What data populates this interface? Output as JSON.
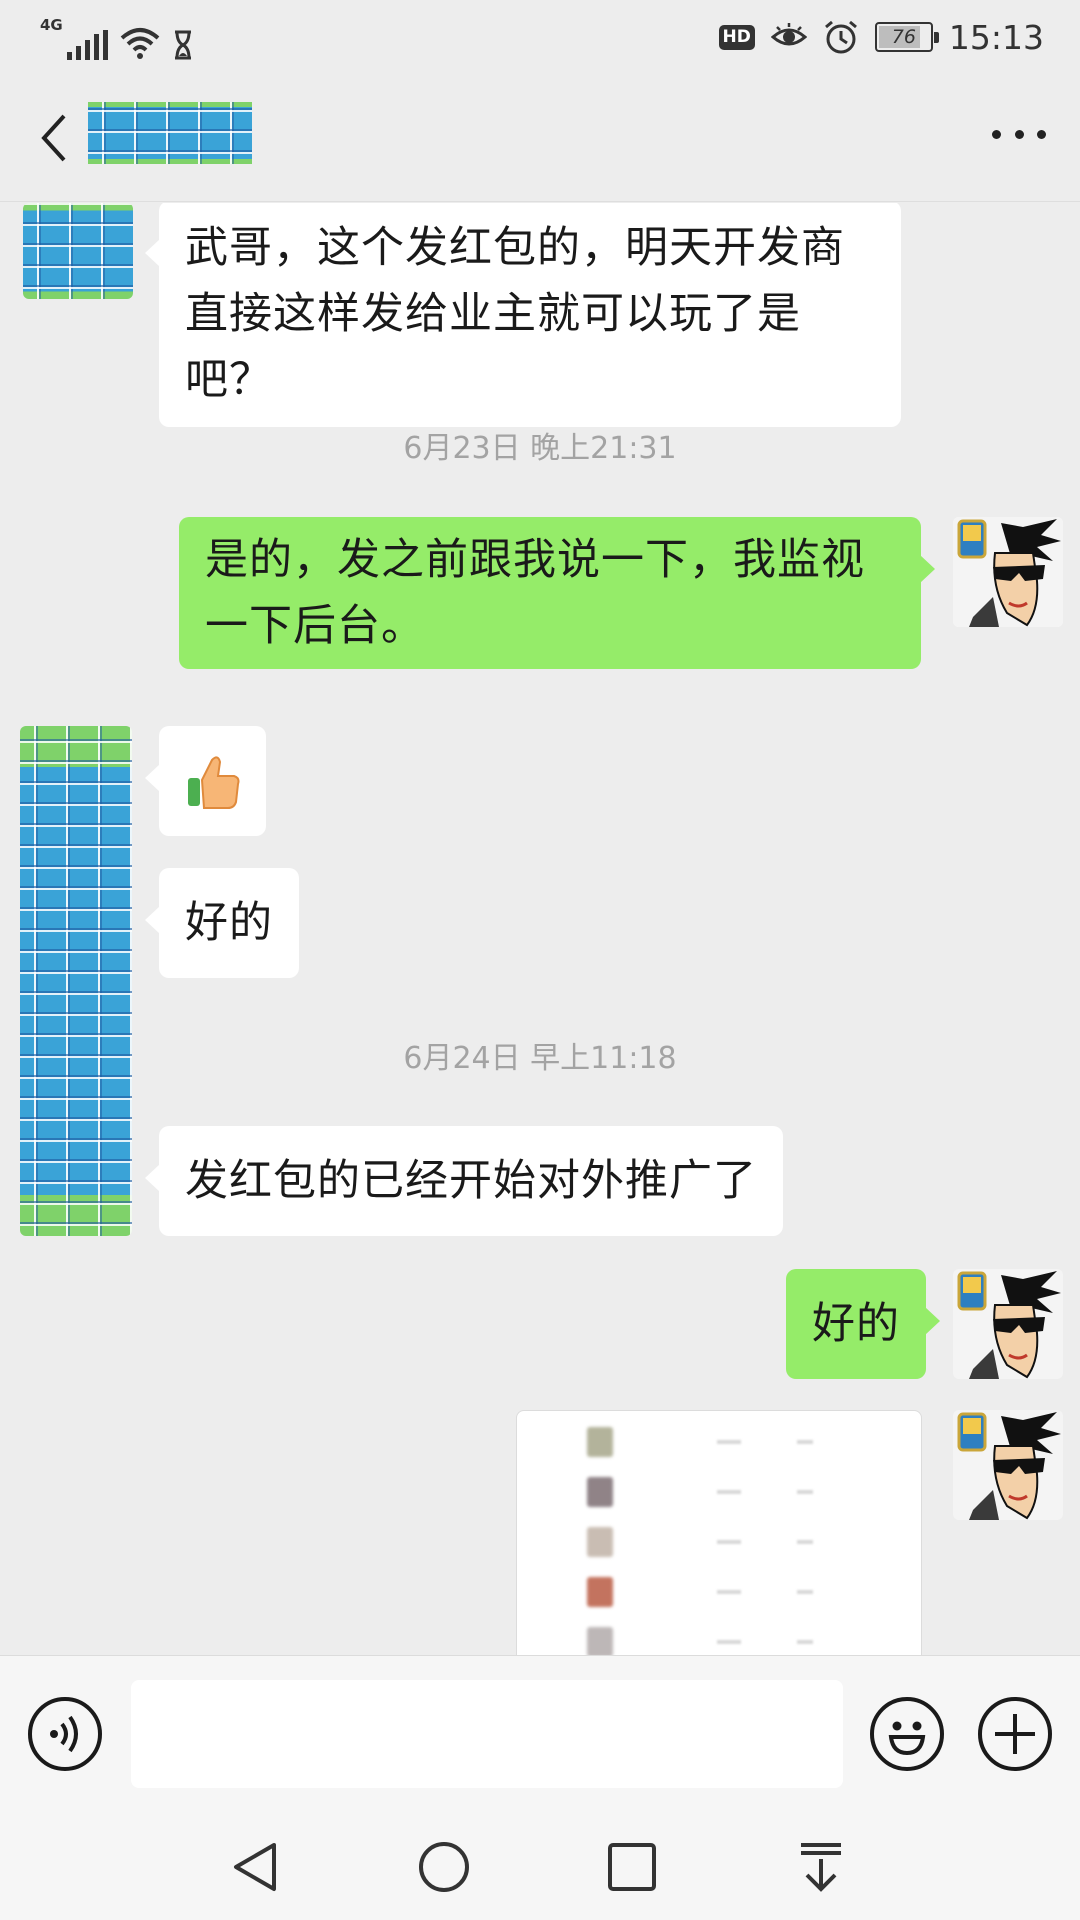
{
  "status_bar": {
    "network": "4G",
    "hd_label": "HD",
    "battery": "76",
    "time": "15:13"
  },
  "header": {
    "contact_name": "",
    "icons": [
      "back-arrow-icon",
      "more-dots-icon"
    ]
  },
  "messages": [
    {
      "direction": "in",
      "line1": "武哥，这个发红包的，明天开发商",
      "line2": "直接这样发给业主就可以玩了是吧？"
    },
    {
      "type": "timestamp",
      "text": "6月23日 晚上21:31"
    },
    {
      "direction": "out",
      "line1": "是的，发之前跟我说一下，我监视",
      "line2": "一下后台。"
    },
    {
      "direction": "in",
      "type": "emoji",
      "emoji": "👍"
    },
    {
      "direction": "in",
      "text": "好的"
    },
    {
      "type": "timestamp",
      "text": "6月24日 早上11:18"
    },
    {
      "direction": "in",
      "text": "发红包的已经开始对外推广了"
    },
    {
      "direction": "out",
      "text": "好的"
    },
    {
      "direction": "out",
      "type": "image"
    }
  ],
  "input_bar": {
    "placeholder": "",
    "icons": [
      "voice-icon",
      "emoji-icon",
      "plus-icon"
    ]
  },
  "nav_bar": {
    "icons": [
      "back-triangle-icon",
      "home-circle-icon",
      "recents-square-icon",
      "notification-pulldown-icon"
    ]
  },
  "colors": {
    "background": "#ededed",
    "outgoing_bubble": "#95ec69",
    "incoming_bubble": "#ffffff",
    "timestamp_text": "#a3a3a3"
  }
}
